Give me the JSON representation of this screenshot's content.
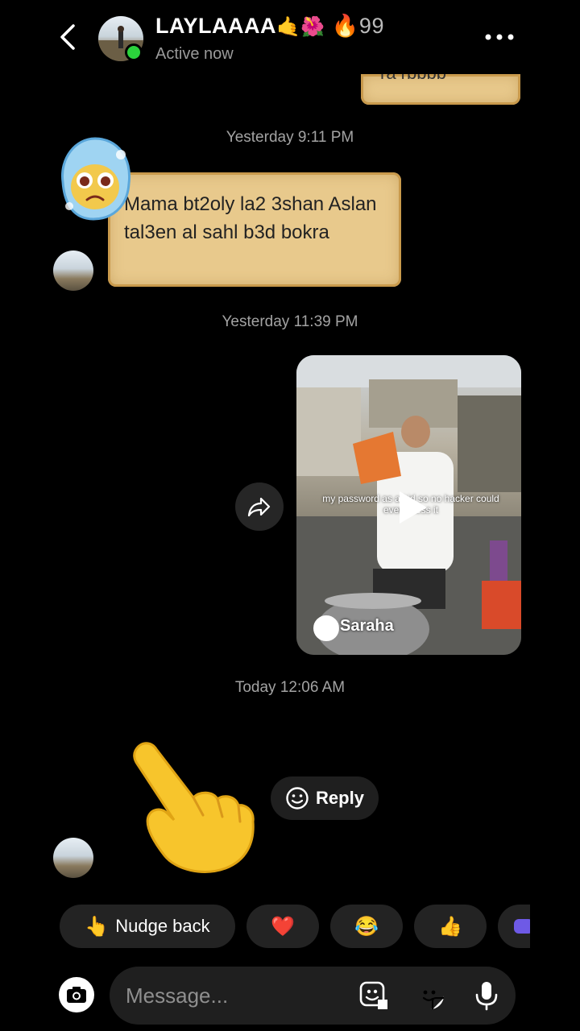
{
  "header": {
    "contact_name": "LAYLAAAA",
    "name_emojis": "🤙🌺",
    "streak_icon": "🔥",
    "streak_count": "99",
    "status": "Active now"
  },
  "thread": {
    "partial_top_bubble": "ra rbbbb",
    "timestamp_1": "Yesterday 9:11 PM",
    "message_1": "Mama bt2oly la2 3shan Aslan tal3en al sahl b3d bokra",
    "timestamp_2": "Yesterday 11:39 PM",
    "shared_video": {
      "caption": "my password as a kid so no hacker could ever guess it",
      "author": "Saraha"
    },
    "timestamp_3": "Today 12:06 AM",
    "reply_label": "Reply",
    "nudge_emoji": "👆"
  },
  "quick_reactions": {
    "nudge_label": "Nudge back",
    "nudge_emoji": "👆",
    "emojis": [
      "❤️",
      "😂",
      "👍"
    ]
  },
  "composer": {
    "placeholder": "Message..."
  },
  "colors": {
    "background": "#000000",
    "bubble_parchment": "#e8c98c",
    "online": "#2bd23c",
    "chip_bg": "#232323"
  }
}
